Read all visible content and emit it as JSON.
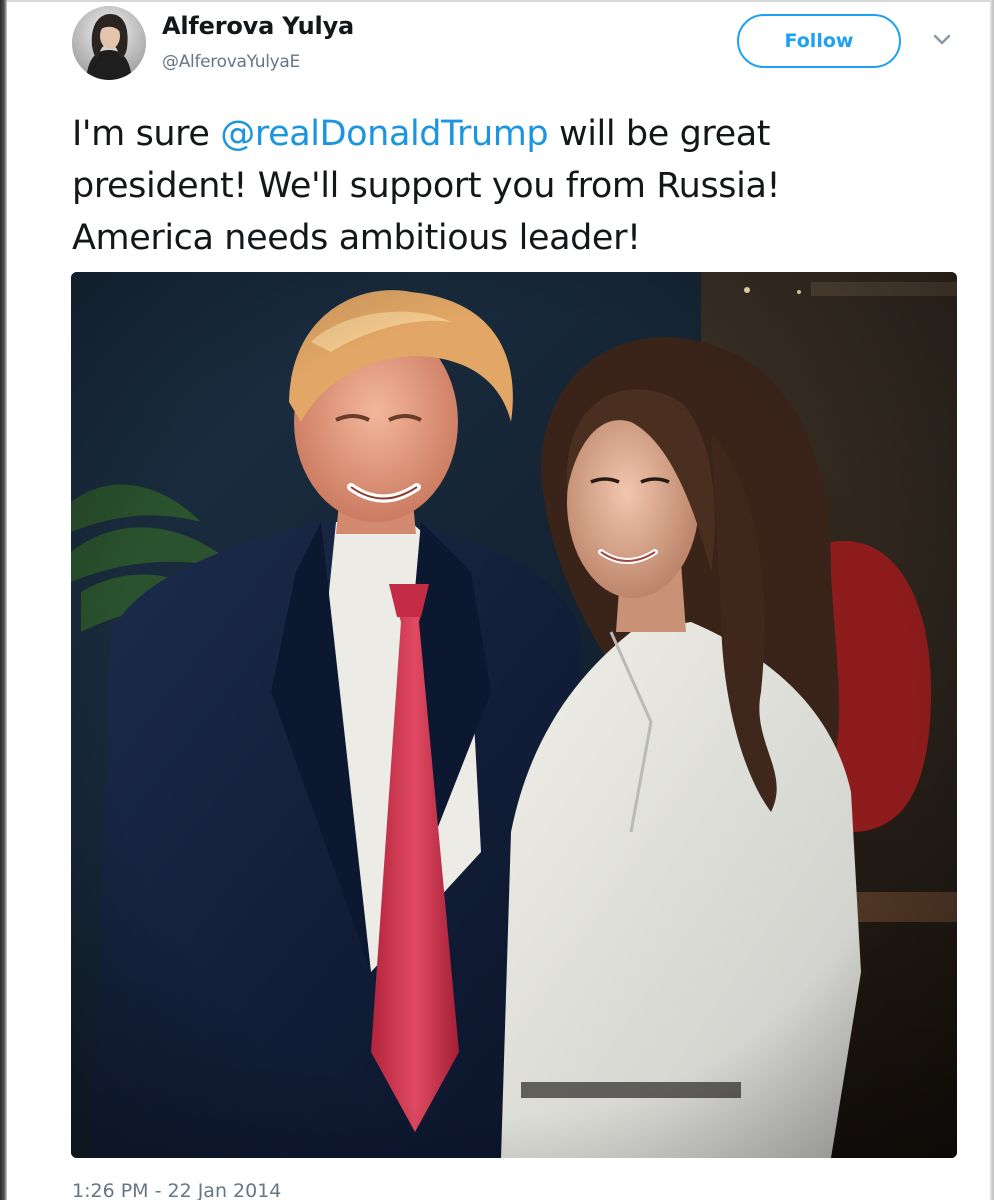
{
  "author": {
    "display_name": "Alferova Yulya",
    "handle": "@AlferovaYulyaE",
    "avatar_icon": "profile-photo"
  },
  "actions": {
    "follow_label": "Follow",
    "menu_icon": "chevron-down-icon"
  },
  "tweet": {
    "line1_pre": "I'm sure ",
    "mention": "@realDonaldTrump",
    "line1_post": " will be great",
    "line2": "president! We'll support you from Russia!",
    "line3": "America needs ambitious leader!"
  },
  "media": {
    "kind": "photo"
  },
  "meta": {
    "timestamp": "1:26 PM - 22 Jan 2014"
  },
  "colors": {
    "link": "#1b95e0",
    "follow_accent": "#1da1f2",
    "text": "#14171a",
    "secondary": "#657786"
  }
}
